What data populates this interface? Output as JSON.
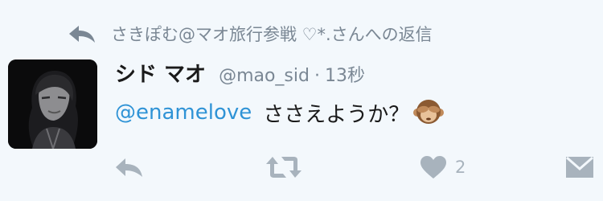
{
  "reply_context": {
    "icon": "reply-arrow-icon",
    "text": "さきぽむ@マオ旅行参戦 ♡*.さんへの返信"
  },
  "user": {
    "display_name": "シド マオ",
    "handle": "@mao_sid",
    "separator": "·",
    "time": "13秒",
    "avatar": "avatar"
  },
  "tweet": {
    "mention": "@enamelove",
    "text": "ささえようか？",
    "emoji": "see-no-evil-monkey-icon"
  },
  "actions": {
    "reply_icon": "reply-icon",
    "retweet_icon": "retweet-icon",
    "like_icon": "heart-icon",
    "like_count": "2",
    "dm_icon": "envelope-icon"
  },
  "colors": {
    "background": "#f3f8fc",
    "muted_text": "#7a8794",
    "action_icon": "#a8b3bd",
    "mention": "#2f93d6",
    "name_text": "#1a1a1a"
  }
}
